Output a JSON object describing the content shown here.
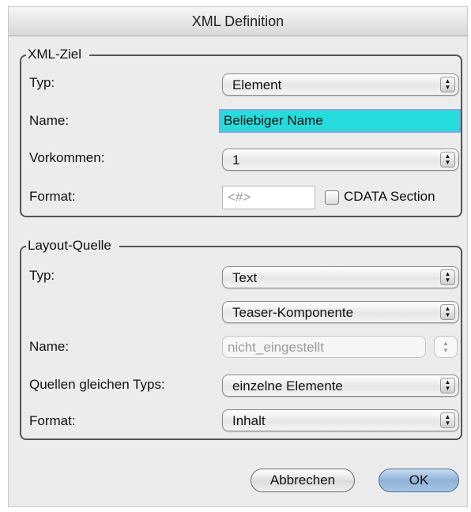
{
  "window": {
    "title": "XML Definition"
  },
  "xml_ziel": {
    "legend": "XML-Ziel",
    "typ": {
      "label": "Typ:",
      "value": "Element"
    },
    "name": {
      "label": "Name:",
      "value": "Beliebiger Name"
    },
    "vorkommen": {
      "label": "Vorkommen:",
      "value": "1"
    },
    "format": {
      "label": "Format:",
      "placeholder": "<#>",
      "checkbox_label": "CDATA Section",
      "checkbox_checked": false
    }
  },
  "layout_quelle": {
    "legend": "Layout-Quelle",
    "typ": {
      "label": "Typ:",
      "value": "Text"
    },
    "komponente": {
      "value": "Teaser-Komponente"
    },
    "name": {
      "label": "Name:",
      "value": "nicht_eingestellt"
    },
    "quellen": {
      "label": "Quellen gleichen Typs:",
      "value": "einzelne Elemente"
    },
    "format": {
      "label": "Format:",
      "value": "Inhalt"
    }
  },
  "buttons": {
    "cancel": "Abbrechen",
    "ok": "OK"
  },
  "icons": {
    "popup_arrows": "▲▼",
    "stepper_arrows": "▲▼"
  }
}
